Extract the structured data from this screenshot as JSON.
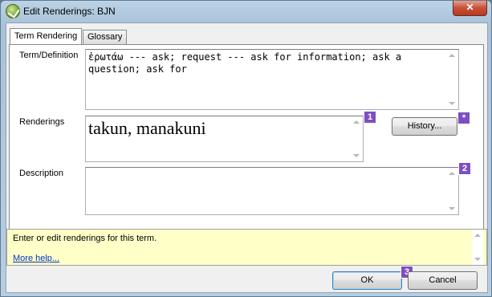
{
  "window": {
    "title": "Edit Renderings: BJN",
    "close_symbol": "✕"
  },
  "tabs": [
    {
      "label": "Term Rendering",
      "active": true
    },
    {
      "label": "Glossary",
      "active": false
    }
  ],
  "term": {
    "label": "Term/Definition",
    "value_line1": "ἐρωτάω --- ask; request --- ask for information; ask a",
    "value_line2": "question; ask for"
  },
  "renderings": {
    "label": "Renderings",
    "value": "takun, manakuni",
    "history_button": "History..."
  },
  "description": {
    "label": "Description",
    "value": ""
  },
  "help": {
    "text": "Enter or edit renderings for this term.",
    "link": "More help..."
  },
  "buttons": {
    "ok": "OK",
    "cancel": "Cancel"
  },
  "badges": {
    "b1": "1",
    "b2": "2",
    "b3": "3",
    "bstar": "*"
  },
  "colors": {
    "badge": "#7d4fc2",
    "help_background": "#ffffc8",
    "link": "#0033cc",
    "close_button": "#c75038"
  },
  "icons": {
    "app": "green-check-circle-icon",
    "close": "close-icon"
  }
}
